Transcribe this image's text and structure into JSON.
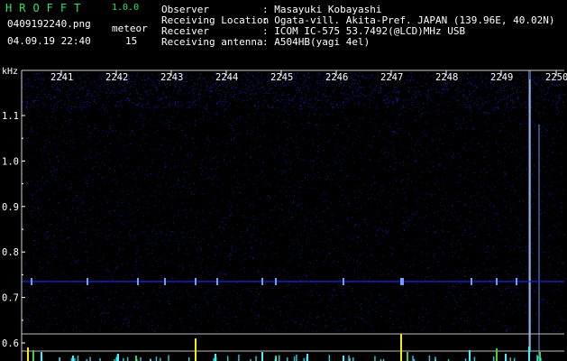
{
  "header": {
    "app_name": "HROFFT",
    "app_version": "1.0.0",
    "filename": "0409192240.png",
    "datetime": "04.09.19 22:40",
    "meteor_label": "meteor",
    "meteor_count": "15",
    "info": [
      {
        "label": "Observer",
        "value": ": Masayuki Kobayashi"
      },
      {
        "label": "Receiving Location",
        "value": ": Ogata-vill. Akita-Pref. JAPAN (139.96E, 40.02N)"
      },
      {
        "label": "Receiver",
        "value": ": ICOM IC-575 53.7492(@LCD)MHz USB"
      },
      {
        "label": "Receiving antenna",
        "value": ": A504HB(yagi 4el)"
      }
    ]
  },
  "spectrogram": {
    "freq_unit": "kHz",
    "freq_ticks": [
      "1.1",
      "1.0",
      "0.9",
      "0.8",
      "0.7",
      "0.6"
    ],
    "freq_tick_values": [
      1.1,
      1.0,
      0.9,
      0.8,
      0.7,
      0.6
    ],
    "time_ticks": [
      "2241",
      "2242",
      "2243",
      "2244",
      "2245",
      "2246",
      "2247",
      "2248",
      "2249",
      "2250"
    ],
    "colors": {
      "background": "#000000",
      "noise": "#1a2ad8",
      "echo": "#6fa0ff",
      "bright_echo": "#e8f0ff",
      "bar_yellow": "#f4f000",
      "bar_cyan": "#3ff0ff",
      "bar_green": "#40d040"
    }
  }
}
